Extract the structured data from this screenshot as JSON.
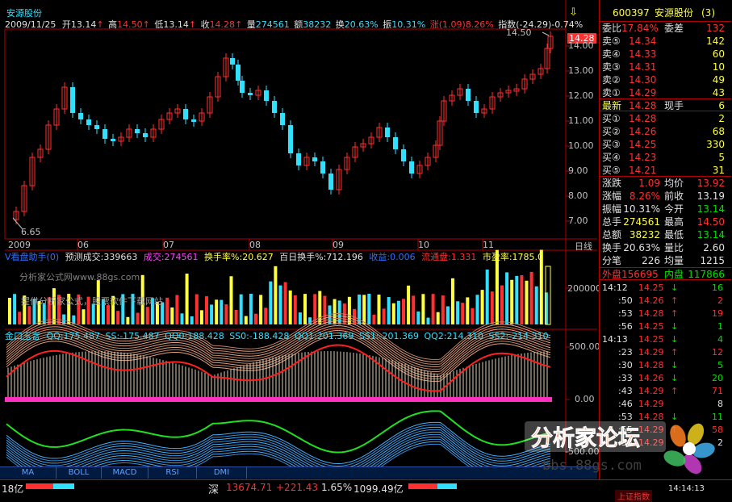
{
  "stock": {
    "name": "安源股份",
    "code": "600397",
    "code_name": "安源股份",
    "tag": "(3)"
  },
  "header": {
    "date": "2009/11/25",
    "open_label": "开",
    "open": "13.14",
    "open_arrow": "↑",
    "high_label": "高",
    "high": "14.50",
    "high_arrow": "↑",
    "low_label": "低",
    "low": "13.14",
    "low_arrow": "↑",
    "close_label": "收",
    "close": "14.28",
    "close_arrow": "↑",
    "vol_label": "量",
    "vol": "274561",
    "amt_label": "额",
    "amt": "38232",
    "turn_label": "换",
    "turn": "20.63%",
    "amp_label": "振",
    "amp": "10.31%",
    "chg_label": "涨",
    "chg": "(1.09)8.26%",
    "index_label": "指数",
    "index_val": "(-24.29)-0.74%"
  },
  "price_axis": [
    "14.00",
    "13.00",
    "12.00",
    "11.00",
    "10.00",
    "9.00",
    "8.00",
    "7.00"
  ],
  "price_marks": {
    "high": "14.50",
    "last": "14.28",
    "low": "6.65"
  },
  "time_axis": [
    "2009",
    "06",
    "07",
    "08",
    "09",
    "10",
    "11"
  ],
  "period_label": "日线",
  "vol_panel": {
    "title": "V看盘助手(0)",
    "pred_label": "预测成交:",
    "pred": "339663",
    "deal_label": "成交:",
    "deal": "274561",
    "turn_label": "换手率%:",
    "turn": "20.627",
    "hundred_label": "百日换手%:",
    "hundred": "712.196",
    "profit_label": "收益:",
    "profit": "0.006",
    "float_label": "流通盘:",
    "float": "1.331",
    "pe_label": "市盈率:",
    "pe": "1785.0",
    "axis": "200000",
    "watermark1": "分析家公式网www.88gs.com",
    "watermark2": "提供分析家公式，股票软件下载网站"
  },
  "osc_panel": {
    "title": "金口玉言",
    "qq_label": "QQ:",
    "qq": "175.487",
    "ss_label": "SS:",
    "ss": "-175.487",
    "qq0_label": "QQ0:",
    "qq0": "188.428",
    "ss0_label": "SS0:",
    "ss0": "-188.428",
    "qq1_label": "QQ1:",
    "qq1": "201.369",
    "ss1_label": "SS1:",
    "ss1": "-201.369",
    "qq2_label": "QQ2:",
    "qq2": "214.310",
    "ss2_label": "SS2:",
    "ss2": "-214.310",
    "axis": [
      "500.00",
      "0.00",
      "-500.00"
    ]
  },
  "tabs": [
    "MA",
    "BOLL",
    "MACD",
    "RSI",
    "DMI"
  ],
  "right": {
    "ratio_label": "委比",
    "ratio": "17.84%",
    "diff_label": "委差",
    "diff": "132",
    "sell": [
      {
        "label": "卖⑤",
        "price": "14.34",
        "vol": "142"
      },
      {
        "label": "卖④",
        "price": "14.33",
        "vol": "60"
      },
      {
        "label": "卖③",
        "price": "14.31",
        "vol": "10"
      },
      {
        "label": "卖②",
        "price": "14.30",
        "vol": "49"
      },
      {
        "label": "卖①",
        "price": "14.29",
        "vol": "43"
      }
    ],
    "last_label": "最新",
    "last": "14.28",
    "hand_label": "现手",
    "hand": "6",
    "buy": [
      {
        "label": "买①",
        "price": "14.28",
        "vol": "2"
      },
      {
        "label": "买②",
        "price": "14.26",
        "vol": "68"
      },
      {
        "label": "买③",
        "price": "14.25",
        "vol": "330"
      },
      {
        "label": "买④",
        "price": "14.23",
        "vol": "5"
      },
      {
        "label": "买⑤",
        "price": "14.21",
        "vol": "31"
      }
    ],
    "stats": [
      {
        "l1": "涨跌",
        "v1": "1.09",
        "l2": "均价",
        "v2": "13.92"
      },
      {
        "l1": "涨幅",
        "v1": "8.26%",
        "l2": "前收",
        "v2": "13.19"
      },
      {
        "l1": "振幅",
        "v1": "10.31%",
        "l2": "今开",
        "v2": "13.14"
      },
      {
        "l1": "总手",
        "v1": "274561",
        "l2": "最高",
        "v2": "14.50"
      },
      {
        "l1": "总额",
        "v1": "38232",
        "l2": "最低",
        "v2": "13.14"
      },
      {
        "l1": "换手",
        "v1": "20.63%",
        "l2": "量比",
        "v2": "2.60"
      },
      {
        "l1": "分笔",
        "v1": "226",
        "l2": "均量",
        "v2": "1215"
      }
    ],
    "outer_label": "外盘",
    "outer": "156695",
    "inner_label": "内盘",
    "inner": "117866",
    "ticks": [
      {
        "t": "14:12",
        "p": "14.25",
        "d": "↓",
        "v": "16"
      },
      {
        "t": ":50",
        "p": "14.26",
        "d": "↑",
        "v": "2"
      },
      {
        "t": ":53",
        "p": "14.28",
        "d": "↑",
        "v": "19"
      },
      {
        "t": ":56",
        "p": "14.25",
        "d": "↓",
        "v": "1"
      },
      {
        "t": "14:13",
        "p": "14.25",
        "d": "↓",
        "v": "4"
      },
      {
        "t": ":23",
        "p": "14.29",
        "d": "↑",
        "v": "12"
      },
      {
        "t": ":30",
        "p": "14.28",
        "d": "↓",
        "v": "5"
      },
      {
        "t": ":33",
        "p": "14.26",
        "d": "↓",
        "v": "20"
      },
      {
        "t": ":43",
        "p": "14.29",
        "d": "↑",
        "v": "71"
      },
      {
        "t": ":46",
        "p": "14.29",
        "d": "",
        "v": "8"
      },
      {
        "t": ":53",
        "p": "14.28",
        "d": "↓",
        "v": "11"
      },
      {
        "t": ":55",
        "p": "14.29",
        "d": "↑",
        "v": "58"
      },
      {
        "t": ":58",
        "p": "14.29",
        "d": "",
        "v": "2"
      }
    ]
  },
  "status": {
    "left": "18亿",
    "sz_label": "深",
    "sz_index": "13674.71",
    "sz_chg": "+221.43",
    "sz_pct": "1.65%",
    "sz_amt": "1099.49亿",
    "clock": "14:14:13",
    "market_tab": "上证指数"
  },
  "watermark": {
    "title": "分析家论坛",
    "url": "bbs.88gs.com"
  }
}
